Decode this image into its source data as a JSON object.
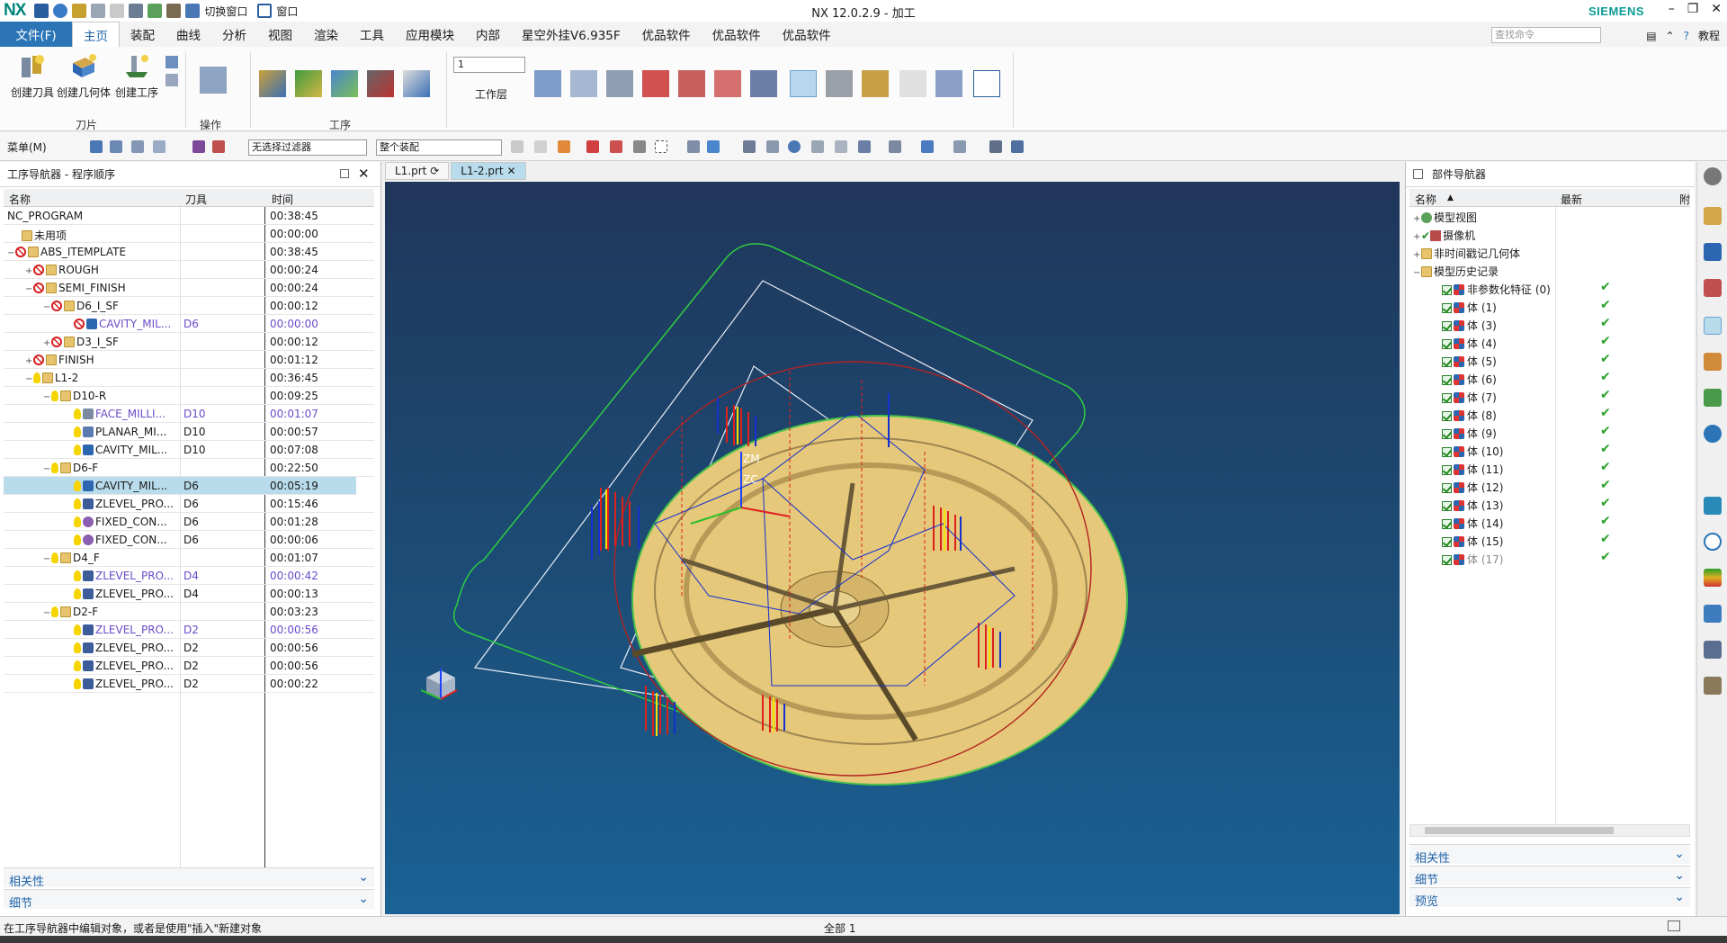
{
  "app": {
    "logo": "NX",
    "title": "NX 12.0.2.9 - 加工",
    "brand": "SIEMENS",
    "switch_window": "切换窗口",
    "window_menu": "窗口"
  },
  "menubar": {
    "items": [
      "文件(F)",
      "主页",
      "装配",
      "曲线",
      "分析",
      "视图",
      "渲染",
      "工具",
      "应用模块",
      "内部",
      "星空外挂V6.935F",
      "优品软件",
      "优品软件",
      "优品软件"
    ],
    "search_placeholder": "查找命令",
    "tutorial": "教程"
  },
  "ribbon": {
    "create_tool": "创建刀具",
    "create_geometry": "创建几何体",
    "create_operation": "创建工序",
    "group_tools": "刀片",
    "group_actions": "操作",
    "group_operation": "工序",
    "layer_value": "1",
    "layer_label": "工作层"
  },
  "toolbar2": {
    "menu": "菜单(M)",
    "filter": "无选择过滤器",
    "scope": "整个装配"
  },
  "operation_navigator": {
    "title": "工序导航器 - 程序顺序",
    "col_name": "名称",
    "col_tool": "刀具",
    "col_time": "时间",
    "rows": [
      {
        "name": "NC_PROGRAM",
        "tool": "",
        "time": "00:38:45"
      },
      {
        "name": "未用项",
        "tool": "",
        "time": "00:00:00"
      },
      {
        "name": "ABS_ITEMPLATE",
        "tool": "",
        "time": "00:38:45"
      },
      {
        "name": "ROUGH",
        "tool": "",
        "time": "00:00:24"
      },
      {
        "name": "SEMI_FINISH",
        "tool": "",
        "time": "00:00:24"
      },
      {
        "name": "D6_I_SF",
        "tool": "",
        "time": "00:00:12"
      },
      {
        "name": "CAVITY_MIL...",
        "tool": "D6",
        "time": "00:00:00"
      },
      {
        "name": "D3_I_SF",
        "tool": "",
        "time": "00:00:12"
      },
      {
        "name": "FINISH",
        "tool": "",
        "time": "00:01:12"
      },
      {
        "name": "L1-2",
        "tool": "",
        "time": "00:36:45"
      },
      {
        "name": "D10-R",
        "tool": "",
        "time": "00:09:25"
      },
      {
        "name": "FACE_MILLI...",
        "tool": "D10",
        "time": "00:01:07"
      },
      {
        "name": "PLANAR_MI...",
        "tool": "D10",
        "time": "00:00:57"
      },
      {
        "name": "CAVITY_MIL...",
        "tool": "D10",
        "time": "00:07:08"
      },
      {
        "name": "D6-F",
        "tool": "",
        "time": "00:22:50"
      },
      {
        "name": "CAVITY_MIL...",
        "tool": "D6",
        "time": "00:05:19"
      },
      {
        "name": "ZLEVEL_PRO...",
        "tool": "D6",
        "time": "00:15:46"
      },
      {
        "name": "FIXED_CON...",
        "tool": "D6",
        "time": "00:01:28"
      },
      {
        "name": "FIXED_CON...",
        "tool": "D6",
        "time": "00:00:06"
      },
      {
        "name": "D4_F",
        "tool": "",
        "time": "00:01:07"
      },
      {
        "name": "ZLEVEL_PRO...",
        "tool": "D4",
        "time": "00:00:42"
      },
      {
        "name": "ZLEVEL_PRO...",
        "tool": "D4",
        "time": "00:00:13"
      },
      {
        "name": "D2-F",
        "tool": "",
        "time": "00:03:23"
      },
      {
        "name": "ZLEVEL_PRO...",
        "tool": "D2",
        "time": "00:00:56"
      },
      {
        "name": "ZLEVEL_PRO...",
        "tool": "D2",
        "time": "00:00:56"
      },
      {
        "name": "ZLEVEL_PRO...",
        "tool": "D2",
        "time": "00:00:56"
      },
      {
        "name": "ZLEVEL_PRO...",
        "tool": "D2",
        "time": "00:00:22"
      }
    ],
    "related": "相关性",
    "details": "细节"
  },
  "tabs": {
    "tab1": "L1.prt",
    "tab2": "L1-2.prt"
  },
  "viewport": {
    "zm": "ZM",
    "zc": "ZC"
  },
  "part_navigator": {
    "title": "部件导航器",
    "col_name": "名称",
    "col_latest": "最新",
    "col_extra": "附",
    "nodes": [
      {
        "name": "模型视图"
      },
      {
        "name": "摄像机"
      },
      {
        "name": "非时间戳记几何体"
      },
      {
        "name": "模型历史记录"
      },
      {
        "name": "非参数化特征 (0)"
      },
      {
        "name": "体 (1)"
      },
      {
        "name": "体 (3)"
      },
      {
        "name": "体 (4)"
      },
      {
        "name": "体 (5)"
      },
      {
        "name": "体 (6)"
      },
      {
        "name": "体 (7)"
      },
      {
        "name": "体 (8)"
      },
      {
        "name": "体 (9)"
      },
      {
        "name": "体 (10)"
      },
      {
        "name": "体 (11)"
      },
      {
        "name": "体 (12)"
      },
      {
        "name": "体 (13)"
      },
      {
        "name": "体 (14)"
      },
      {
        "name": "体 (15)"
      },
      {
        "name": "体 (17)"
      }
    ],
    "related": "相关性",
    "details": "细节",
    "preview": "预览"
  },
  "status": {
    "message": "在工序导航器中编辑对象，或者是使用\"插入\"新建对象",
    "center": "全部 1"
  },
  "colors": {
    "accent": "#2b75b7",
    "part": "#e3c77a",
    "path_red": "#e0201a",
    "path_blue": "#1530d0",
    "path_yellow": "#f7e200",
    "ok_green": "#2aa02a"
  }
}
